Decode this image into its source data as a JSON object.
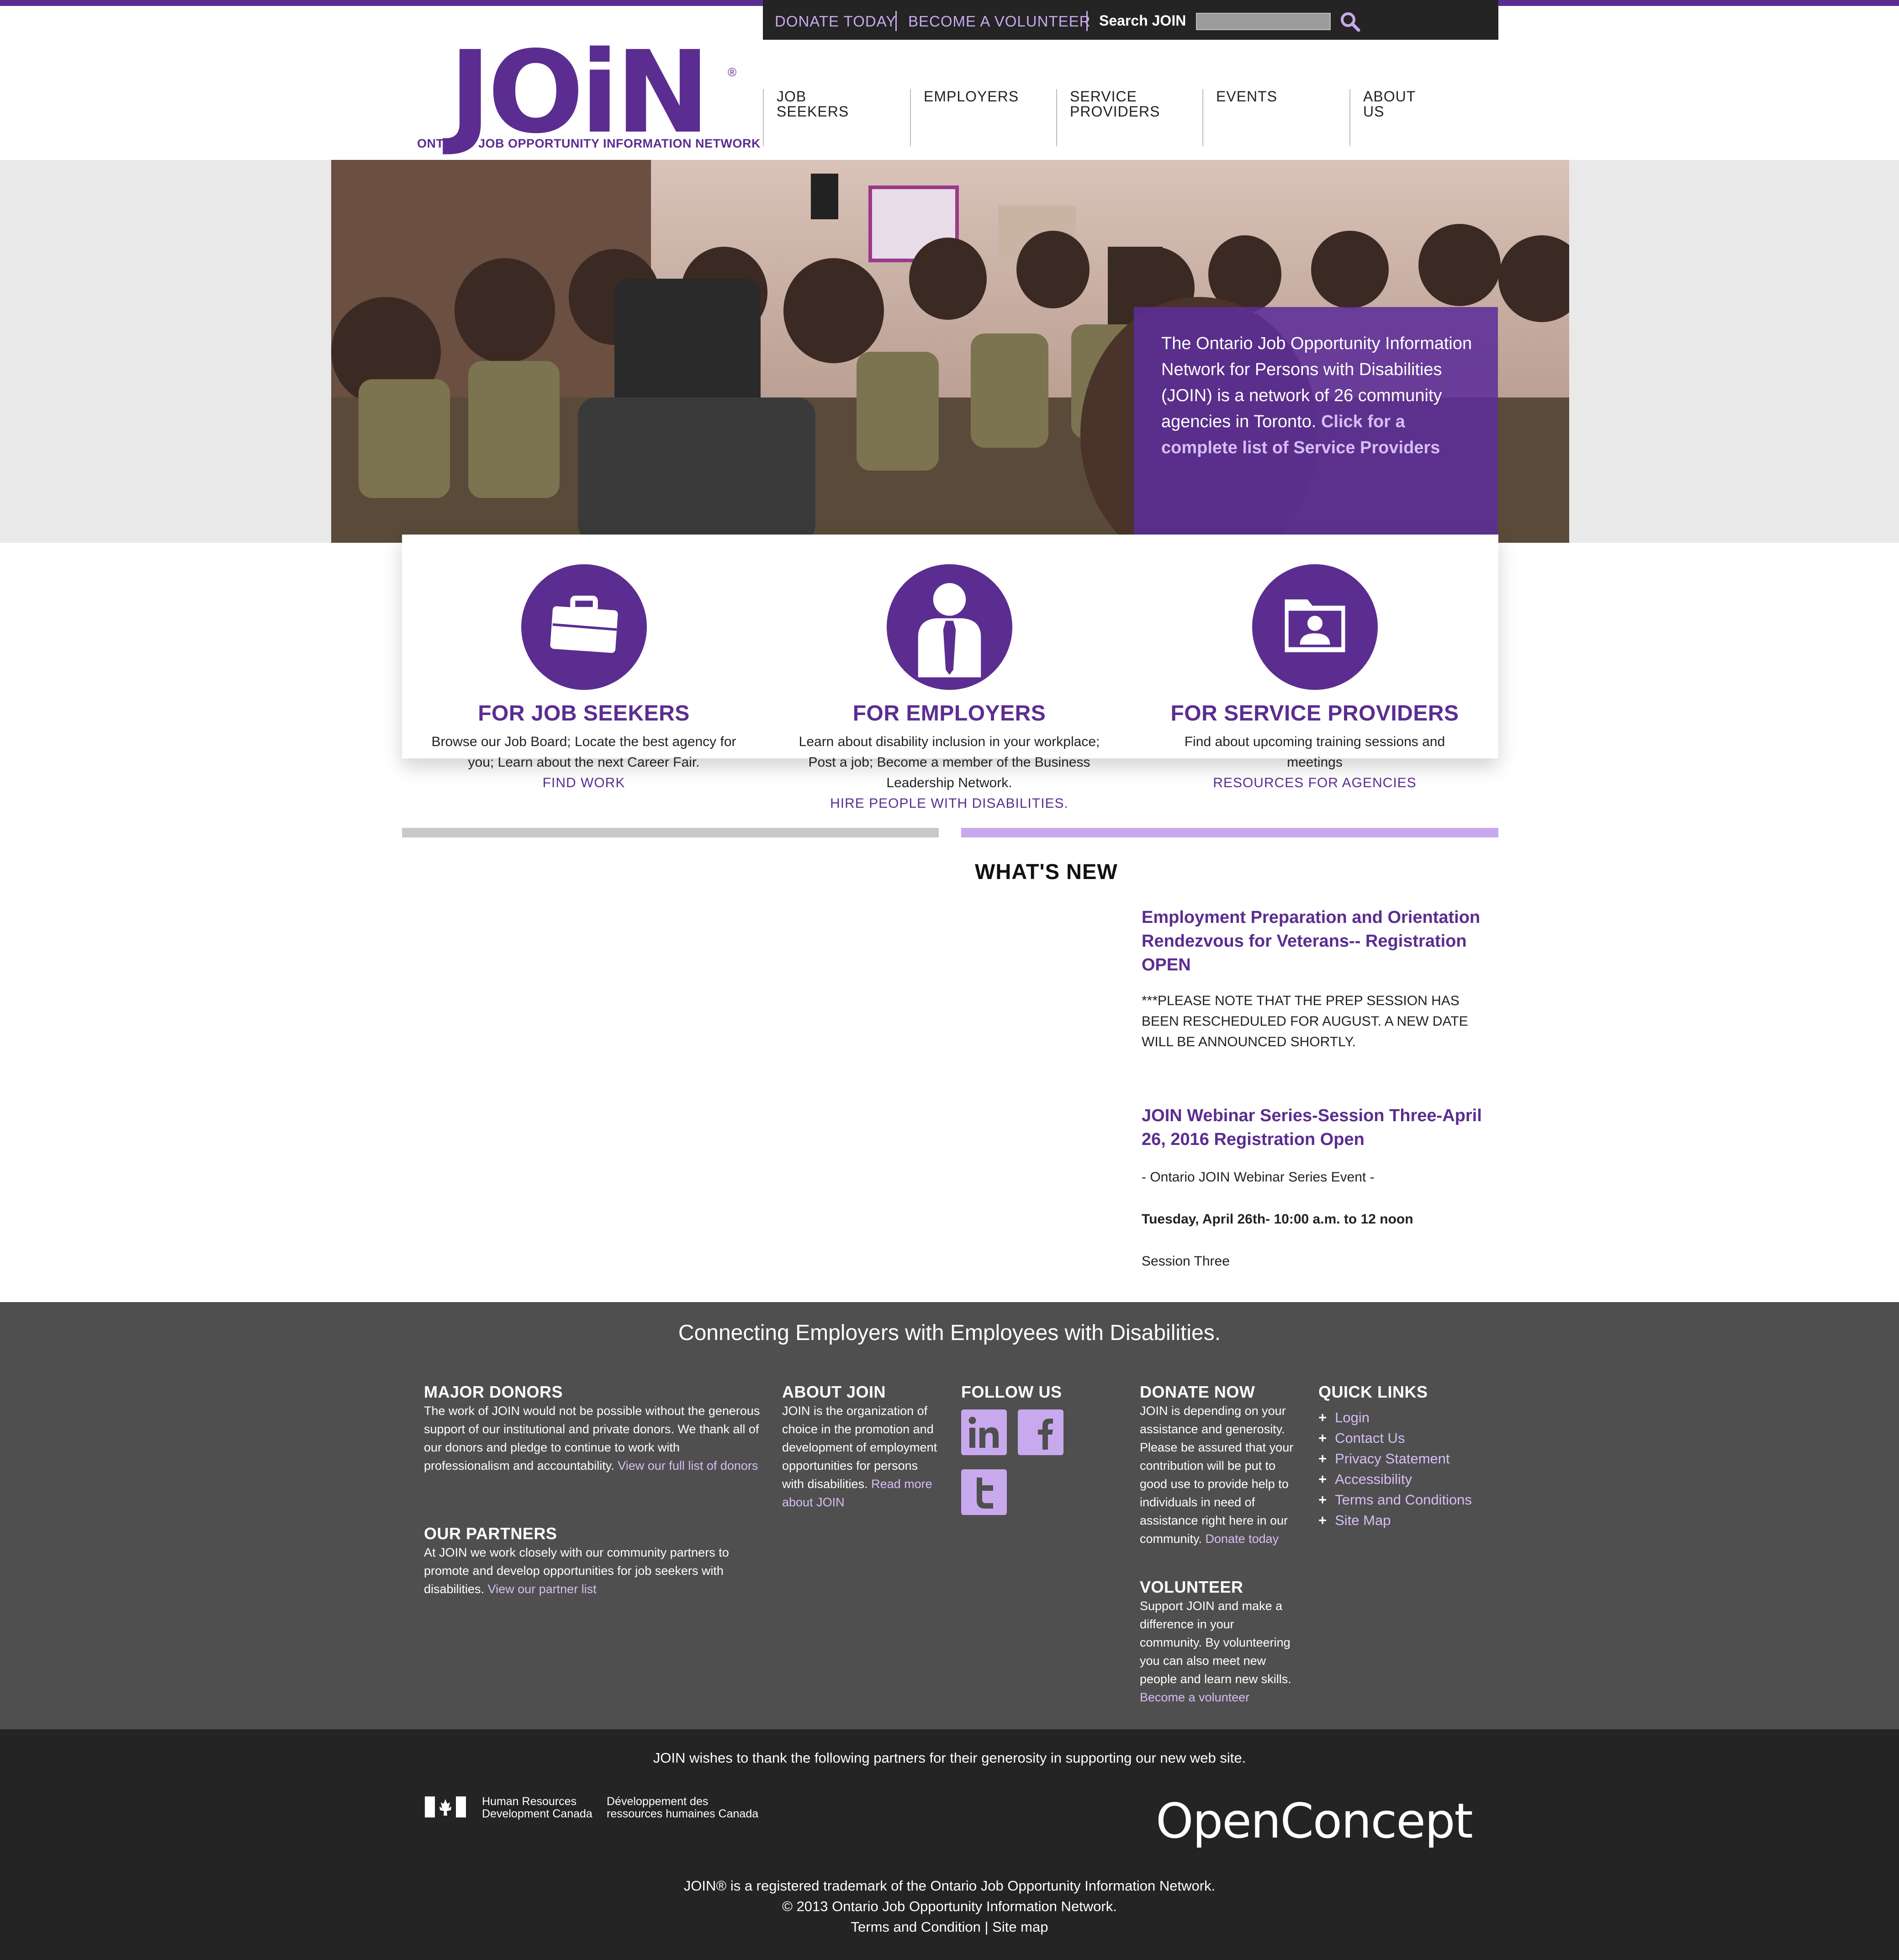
{
  "utility": {
    "donate": "DONATE TODAY",
    "volunteer": "BECOME A VOLUNTEER",
    "search_label": "Search JOIN",
    "search_value": ""
  },
  "logo": {
    "word": "JOiN",
    "reg": "®",
    "subtitle": "ONTARIO JOB OPPORTUNITY INFORMATION NETWORK"
  },
  "nav": [
    {
      "line1": "JOB",
      "line2": "SEEKERS"
    },
    {
      "line1": "EMPLOYERS",
      "line2": ""
    },
    {
      "line1": "SERVICE",
      "line2": "PROVIDERS"
    },
    {
      "line1": "EVENTS",
      "line2": ""
    },
    {
      "line1": "ABOUT",
      "line2": "US"
    }
  ],
  "hero": {
    "text": "The Ontario Job Opportunity Information Network for Persons with Disabilities (JOIN) is a network of 26 community agencies in Toronto.",
    "link": "Click for a complete list of Service Providers"
  },
  "features": [
    {
      "icon": "briefcase-icon",
      "title": "FOR JOB SEEKERS",
      "desc": "Browse our Job Board; Locate the best agency for you; Learn about the next Career Fair.",
      "link": "FIND WORK"
    },
    {
      "icon": "businessman-icon",
      "title": "FOR EMPLOYERS",
      "desc": "Learn about disability inclusion in your workplace; Post a job; Become a member of the Business Leadership Network.",
      "link": "HIRE PEOPLE WITH DISABILITIES."
    },
    {
      "icon": "folder-person-icon",
      "title": "FOR SERVICE PROVIDERS",
      "desc": "Find about upcoming training sessions and meetings",
      "link": "RESOURCES FOR AGENCIES"
    }
  ],
  "whats_new": {
    "title": "WHAT'S NEW",
    "items": [
      {
        "title": "Employment Preparation and Orientation Rendezvous for Veterans-- Registration OPEN",
        "body": "***PLEASE NOTE THAT THE PREP SESSION HAS BEEN RESCHEDULED FOR AUGUST. A NEW DATE WILL BE ANNOUNCED SHORTLY."
      },
      {
        "title": "JOIN Webinar Series-Session Three-April 26, 2016 Registration Open",
        "line1": "- Ontario JOIN Webinar Series Event -",
        "line2": "Tuesday, April 26th- 10:00 a.m. to 12 noon",
        "line3": "Session Three"
      }
    ]
  },
  "footer": {
    "tagline": "Connecting Employers with Employees with Disabilities.",
    "donors": {
      "title": "MAJOR DONORS",
      "text": "The work of JOIN would not be possible without the generous support of our institutional and private donors. We thank all of our donors and pledge to continue to work with professionalism and accountability.",
      "link": "View our full list of donors"
    },
    "partners": {
      "title": "OUR PARTNERS",
      "text": "At JOIN we work closely with our community partners to promote and develop opportunities for job seekers with disabilities.",
      "link": "View our partner list"
    },
    "about": {
      "title": "ABOUT JOIN",
      "text": "JOIN is the organization of choice in the promotion and development of employment opportunities for persons with disabilities.",
      "link": "Read more about JOIN"
    },
    "follow": {
      "title": "FOLLOW US",
      "icons": [
        "linkedin-icon",
        "facebook-icon",
        "twitter-icon"
      ]
    },
    "donate": {
      "title": "DONATE NOW",
      "text": "JOIN is depending on your assistance and generosity. Please be assured that your contribution will be put to good use to provide help to individuals in need of assistance right here in our community.",
      "link": "Donate today"
    },
    "volunteer": {
      "title": "VOLUNTEER",
      "text": "Support JOIN and make a difference in your community. By volunteering you can also meet new people and learn new skills.",
      "link": "Become a volunteer"
    },
    "quick": {
      "title": "QUICK LINKS",
      "items": [
        "Login",
        "Contact Us",
        "Privacy Statement",
        "Accessibility",
        "Terms and Conditions",
        "Site Map"
      ]
    }
  },
  "bottom": {
    "thanks": "JOIN wishes to thank the following partners for their generosity in supporting our new web site.",
    "hrdc_en1": "Human Resources",
    "hrdc_en2": "Development Canada",
    "hrdc_fr1": "Développement des",
    "hrdc_fr2": "ressources humaines Canada",
    "openconcept": "OpenConcept",
    "trademark": "JOIN® is a registered trademark of the Ontario Job Opportunity Information Network.",
    "copyright": "© 2013 Ontario Job Opportunity Information Network.",
    "terms": "Terms and Condition",
    "sep": "|",
    "sitemap": "Site map"
  },
  "colors": {
    "brand_purple": "#5b2d90",
    "light_purple": "#c9a9ee",
    "footer_gray": "#4f4f4f",
    "bottom_dark": "#242424"
  }
}
